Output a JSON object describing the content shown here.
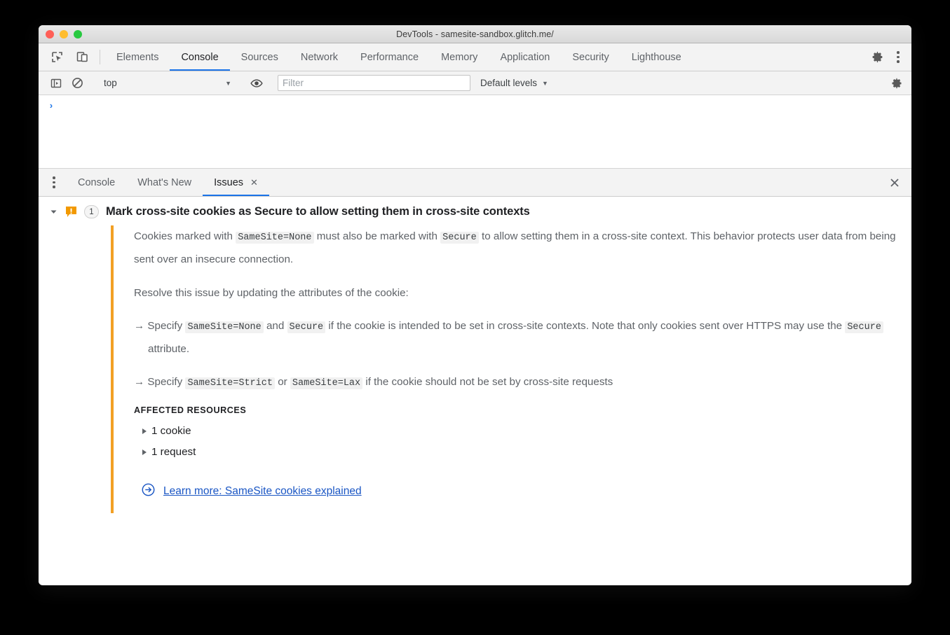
{
  "window": {
    "title": "DevTools - samesite-sandbox.glitch.me/"
  },
  "main_toolbar": {
    "inspect_icon": "inspect-element-icon",
    "device_icon": "device-toolbar-icon",
    "tabs": [
      {
        "label": "Elements",
        "active": false
      },
      {
        "label": "Console",
        "active": true
      },
      {
        "label": "Sources",
        "active": false
      },
      {
        "label": "Network",
        "active": false
      },
      {
        "label": "Performance",
        "active": false
      },
      {
        "label": "Memory",
        "active": false
      },
      {
        "label": "Application",
        "active": false
      },
      {
        "label": "Security",
        "active": false
      },
      {
        "label": "Lighthouse",
        "active": false
      }
    ],
    "settings_icon": "gear-icon",
    "more_icon": "kebab-menu-icon"
  },
  "filter_bar": {
    "sidebar_toggle_icon": "show-console-sidebar-icon",
    "clear_icon": "clear-console-icon",
    "context": "top",
    "context_caret": "▼",
    "eye_icon": "live-expression-eye-icon",
    "filter_value": "",
    "filter_placeholder": "Filter",
    "levels_label": "Default levels",
    "levels_caret": "▼",
    "settings_icon": "console-settings-gear-icon"
  },
  "console": {
    "prompt": "›"
  },
  "drawer": {
    "more_icon": "drawer-kebab-icon",
    "tabs": [
      {
        "label": "Console",
        "active": false,
        "closeable": false
      },
      {
        "label": "What's New",
        "active": false,
        "closeable": false
      },
      {
        "label": "Issues",
        "active": true,
        "closeable": true,
        "close_glyph": "✕"
      }
    ],
    "close_drawer_glyph": "✕"
  },
  "issue": {
    "disclosure_glyph": "▼",
    "severity_icon": "warning-issue-icon",
    "severity_color": "#f29900",
    "count": "1",
    "title": "Mark cross-site cookies as Secure to allow setting them in cross-site contexts",
    "accent_color": "#f2a025",
    "paragraph1": {
      "part1": "Cookies marked with ",
      "code1": "SameSite=None",
      "part2": " must also be marked with ",
      "code2": "Secure",
      "part3": " to allow setting them in a cross-site context. This behavior protects user data from being sent over an insecure connection."
    },
    "paragraph2": "Resolve this issue by updating the attributes of the cookie:",
    "bullet1": {
      "arrow": "→",
      "part1": " Specify ",
      "code1": "SameSite=None",
      "part2": " and ",
      "code2": "Secure",
      "part3": " if the cookie is intended to be set in cross-site contexts. Note that only cookies sent over HTTPS may use the ",
      "code3": "Secure",
      "part4": " attribute."
    },
    "bullet2": {
      "arrow": "→",
      "part1": " Specify ",
      "code1": "SameSite=Strict",
      "part2": " or ",
      "code2": "SameSite=Lax",
      "part3": " if the cookie should not be set by cross-site requests"
    },
    "affected_resources_label": "AFFECTED RESOURCES",
    "resources": [
      {
        "label": "1 cookie"
      },
      {
        "label": "1 request"
      }
    ],
    "learn_more": {
      "icon": "external-link-circle-arrow-icon",
      "label": "Learn more: SameSite cookies explained",
      "color": "#1a56c4"
    }
  }
}
